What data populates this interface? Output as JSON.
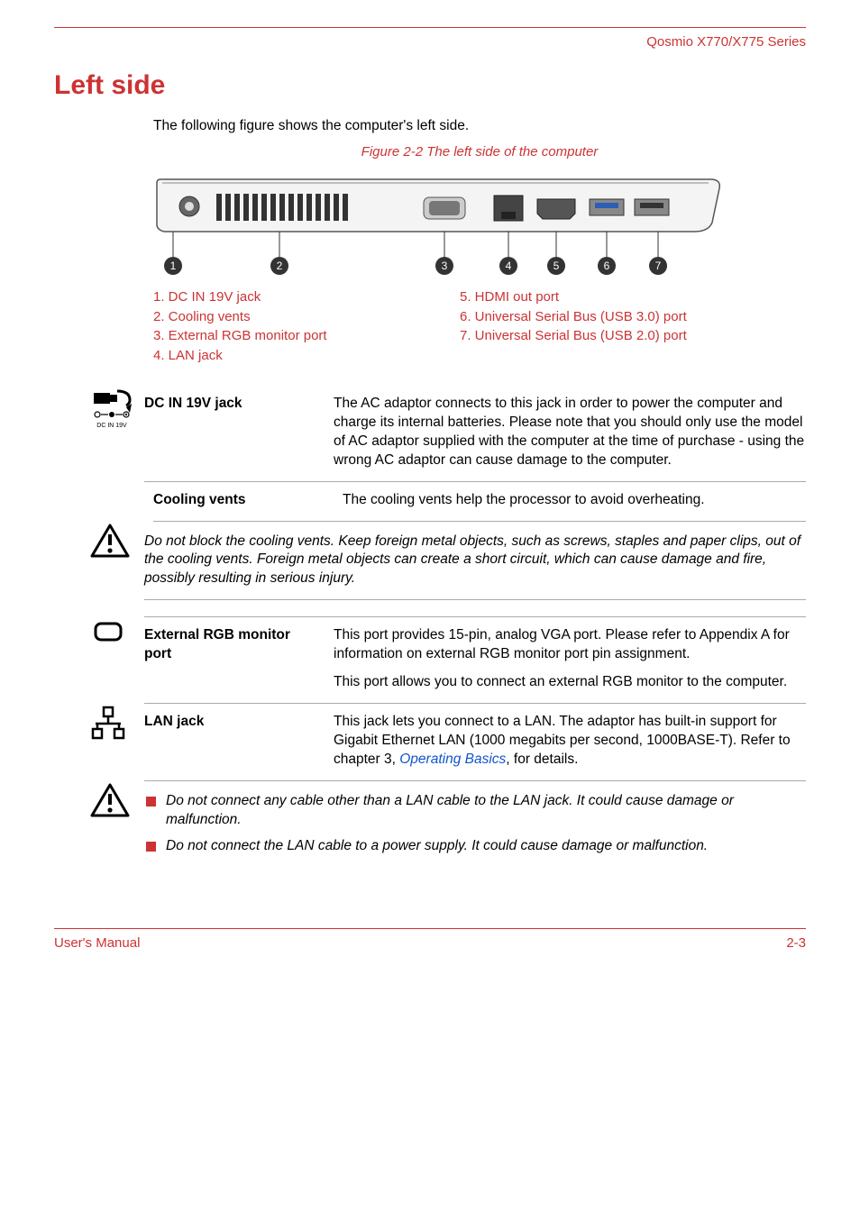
{
  "header": {
    "series": "Qosmio X770/X775 Series"
  },
  "section": {
    "title": "Left side",
    "intro": "The following figure shows the computer's left side."
  },
  "figure": {
    "caption": "Figure 2-2 The left side of the computer"
  },
  "legend": {
    "left": [
      "1. DC IN 19V jack",
      "2. Cooling vents",
      "3. External RGB monitor port",
      "4. LAN jack"
    ],
    "right": [
      "5. HDMI out port",
      "6. Universal Serial Bus (USB 3.0) port",
      "7. Universal Serial Bus (USB 2.0) port"
    ]
  },
  "specs": {
    "dcin": {
      "term": "DC IN 19V jack",
      "desc": "The AC adaptor connects to this jack in order to power the computer and charge its internal batteries. Please note that you should only use the model of AC adaptor supplied with the computer at the time of purchase - using the wrong AC adaptor can cause damage to the computer."
    },
    "cooling": {
      "term": "Cooling vents",
      "desc": "The cooling vents help the processor to avoid overheating."
    },
    "rgb": {
      "term": "External RGB monitor port",
      "desc1": "This port provides 15-pin, analog VGA port. Please refer to Appendix A for information on external RGB monitor port pin assignment.",
      "desc2": "This port allows you to connect an external RGB monitor to the computer."
    },
    "lan": {
      "term": "LAN jack",
      "desc_pre": "This jack lets you connect to a LAN. The adaptor has built-in support for Gigabit Ethernet LAN (1000 megabits per second, 1000BASE-T). Refer to chapter 3, ",
      "link": "Operating Basics",
      "desc_post": ", for details."
    }
  },
  "warnings": {
    "cooling": "Do not block the cooling vents. Keep foreign metal objects, such as screws, staples and paper clips, out of the cooling vents. Foreign metal objects can create a short circuit, which can cause damage and fire, possibly resulting in serious injury.",
    "lan1": "Do not connect any cable other than a LAN cable to the LAN jack. It could cause damage or malfunction.",
    "lan2": "Do not connect the LAN cable to a power supply. It could cause damage or malfunction."
  },
  "footer": {
    "left": "User's Manual",
    "right": "2-3"
  },
  "icons": {
    "dcin_sub": "DC IN 19V"
  }
}
